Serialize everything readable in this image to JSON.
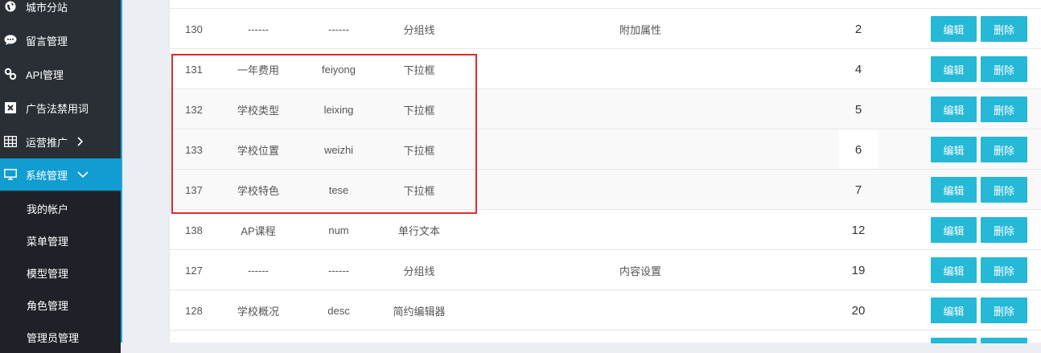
{
  "sidebar": {
    "items": [
      {
        "label": "城市分站",
        "icon": "globe-icon"
      },
      {
        "label": "留言管理",
        "icon": "comment-icon"
      },
      {
        "label": "API管理",
        "icon": "link-icon"
      },
      {
        "label": "广告法禁用词",
        "icon": "close-box-icon"
      },
      {
        "label": "运营推广",
        "icon": "table-icon"
      },
      {
        "label": "系统管理",
        "icon": "monitor-icon"
      }
    ],
    "sub_items": [
      {
        "label": "我的帐户"
      },
      {
        "label": "菜单管理"
      },
      {
        "label": "模型管理"
      },
      {
        "label": "角色管理"
      },
      {
        "label": "管理员管理"
      }
    ]
  },
  "table": {
    "rows": [
      {
        "id": "130",
        "name": "------",
        "field": "------",
        "type": "分组线",
        "group": "附加属性",
        "order": "2"
      },
      {
        "id": "131",
        "name": "一年费用",
        "field": "feiyong",
        "type": "下拉框",
        "group": "",
        "order": "4"
      },
      {
        "id": "132",
        "name": "学校类型",
        "field": "leixing",
        "type": "下拉框",
        "group": "",
        "order": "5"
      },
      {
        "id": "133",
        "name": "学校位置",
        "field": "weizhi",
        "type": "下拉框",
        "group": "",
        "order": "6"
      },
      {
        "id": "137",
        "name": "学校特色",
        "field": "tese",
        "type": "下拉框",
        "group": "",
        "order": "7"
      },
      {
        "id": "138",
        "name": "AP课程",
        "field": "num",
        "type": "单行文本",
        "group": "",
        "order": "12"
      },
      {
        "id": "127",
        "name": "------",
        "field": "------",
        "type": "分组线",
        "group": "内容设置",
        "order": "19"
      },
      {
        "id": "128",
        "name": "学校概况",
        "field": "desc",
        "type": "简约编辑器",
        "group": "",
        "order": "20"
      }
    ],
    "edit_label": "编辑",
    "delete_label": "删除"
  },
  "colors": {
    "sidebar_bg": "#2a2f36",
    "active": "#119dd1",
    "button": "#25b8d7",
    "highlight": "#e02b2b"
  }
}
